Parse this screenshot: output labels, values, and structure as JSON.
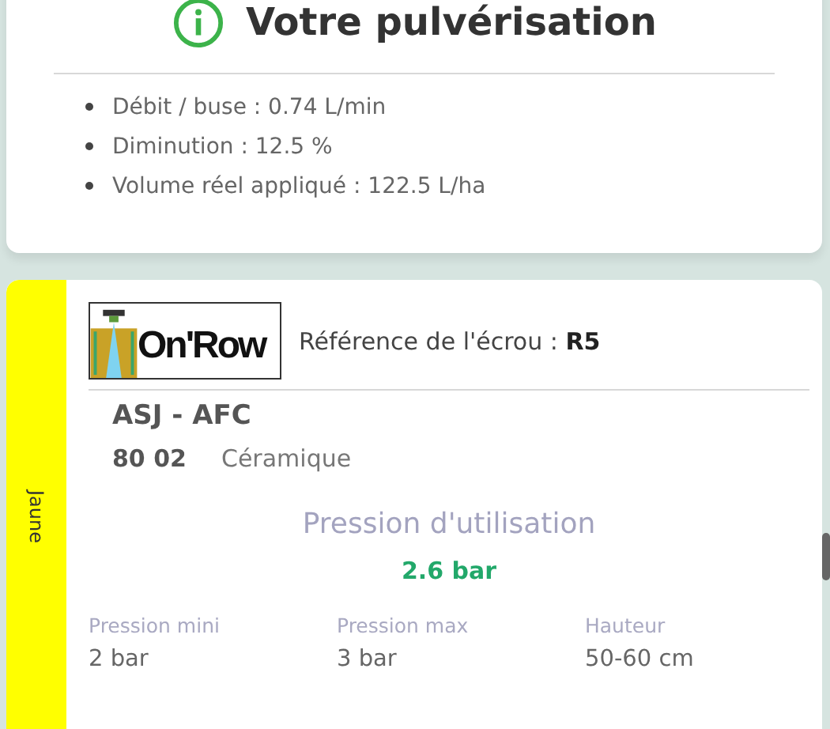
{
  "summary": {
    "title": "Votre pulvérisation",
    "items": [
      "Débit / buse : 0.74 L/min",
      "Diminution : 12.5 %",
      "Volume réel appliqué : 122.5 L/ha"
    ]
  },
  "nozzle": {
    "color_label": "Jaune",
    "color": "#ffff00",
    "logo_text": "On'Row",
    "reference_label": "Référence de l'écrou : ",
    "reference": "R5",
    "model": "ASJ - AFC",
    "size": "80 02",
    "material": "Céramique",
    "pressure_title": "Pression d'utilisation",
    "pressure": "2.6 bar",
    "specs": [
      {
        "label": "Pression mini",
        "value": "2 bar"
      },
      {
        "label": "Pression max",
        "value": "3 bar"
      },
      {
        "label": "Hauteur",
        "value": "50-60 cm"
      }
    ]
  }
}
